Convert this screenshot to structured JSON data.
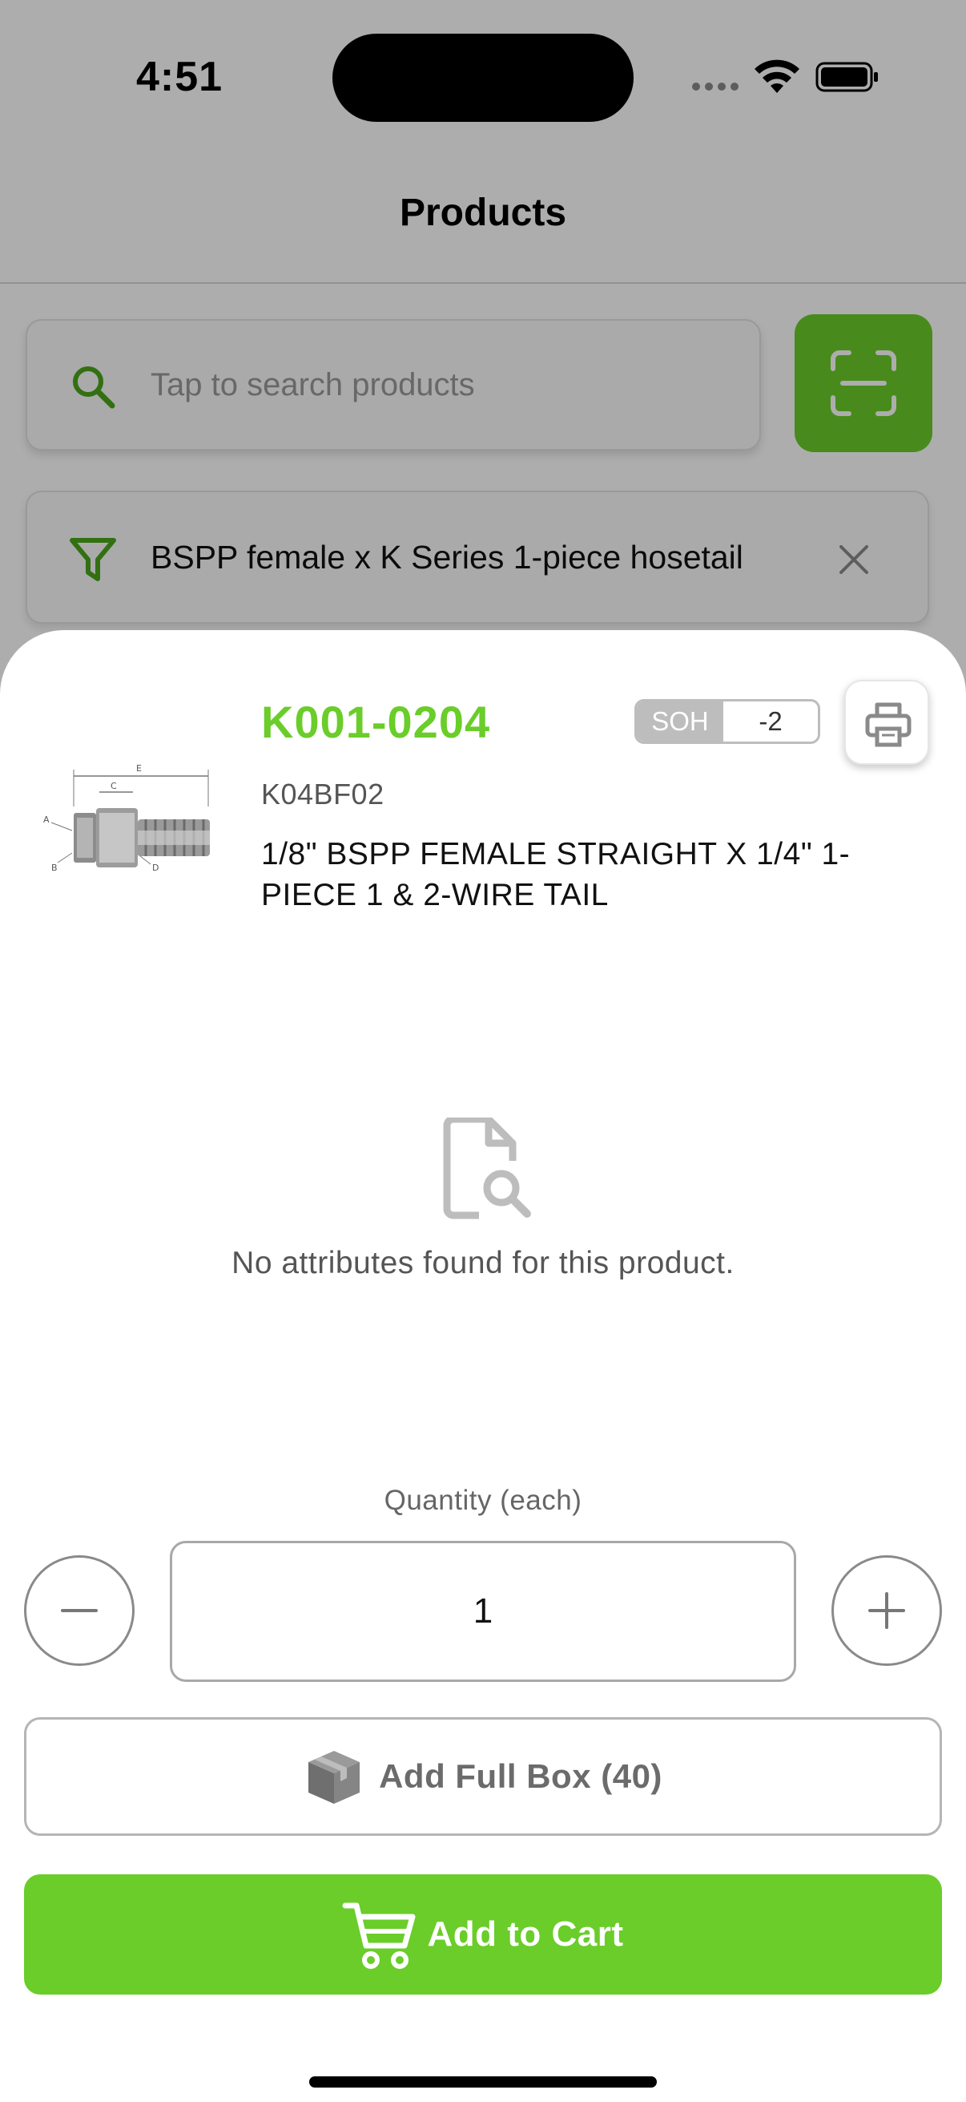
{
  "status_bar": {
    "time": "4:51"
  },
  "header": {
    "title": "Products"
  },
  "search": {
    "placeholder": "Tap to search products"
  },
  "filter": {
    "text": "BSPP female x K Series 1-piece hosetail"
  },
  "product": {
    "code": "K001-0204",
    "soh_label": "SOH",
    "soh_value": "-2",
    "supplier_code": "K04BF02",
    "description": "1/8\" BSPP FEMALE STRAIGHT X 1/4\" 1-PIECE 1 & 2-WIRE TAIL",
    "image_labels": [
      "A",
      "B",
      "C",
      "D",
      "E"
    ]
  },
  "attributes": {
    "empty_message": "No attributes found for this product."
  },
  "quantity": {
    "label": "Quantity (each)",
    "value": "1"
  },
  "actions": {
    "full_box_label": "Add Full Box (40)",
    "add_to_cart_label": "Add to Cart"
  },
  "colors": {
    "accent": "#6acd2a",
    "scrim": "rgba(0,0,0,0.32)",
    "badge_gray": "#bdbdbd"
  },
  "icons": [
    "search-icon",
    "scan-icon",
    "filter-icon",
    "close-icon",
    "print-icon",
    "document-search-icon",
    "minus-icon",
    "plus-icon",
    "box-icon",
    "cart-icon"
  ]
}
